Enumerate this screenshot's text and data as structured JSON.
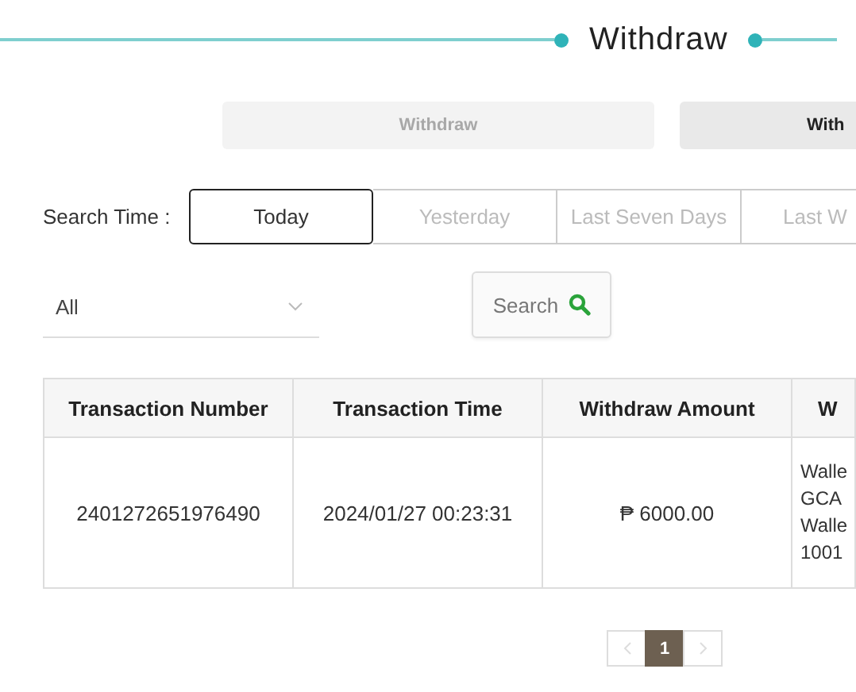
{
  "title": "Withdraw",
  "tabs": [
    {
      "label": "Withdraw",
      "selected": false
    },
    {
      "label": "With",
      "selected": true
    }
  ],
  "search_time": {
    "label": "Search Time :",
    "options": [
      {
        "label": "Today",
        "selected": true
      },
      {
        "label": "Yesterday",
        "selected": false
      },
      {
        "label": "Last Seven Days",
        "selected": false
      },
      {
        "label": "Last W",
        "selected": false
      }
    ]
  },
  "filter": {
    "value": "All"
  },
  "search_button": "Search",
  "table": {
    "columns": [
      "Transaction Number",
      "Transaction Time",
      "Withdraw Amount",
      "W"
    ],
    "rows": [
      {
        "cells": [
          "2401272651976490",
          "2024/01/27 00:23:31",
          "₱ 6000.00",
          [
            "Walle",
            "GCA",
            "Walle",
            "1001"
          ]
        ]
      }
    ]
  },
  "pagination": {
    "pages": [
      {
        "label": "1",
        "selected": true
      }
    ]
  }
}
